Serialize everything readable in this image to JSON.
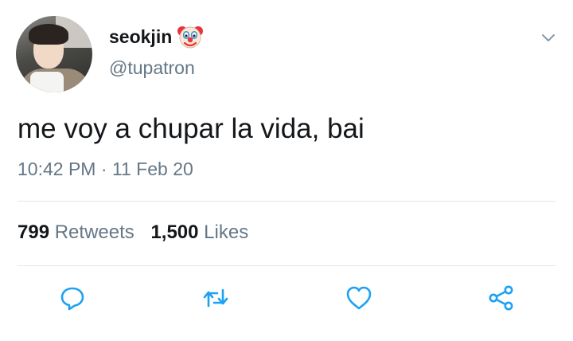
{
  "tweet": {
    "author": {
      "display_name": "seokjin",
      "handle": "@tupatron",
      "name_emoji": "clown-face-icon"
    },
    "text": "me voy a chupar la vida, bai",
    "time": "10:42 PM",
    "separator": "·",
    "date": "11 Feb 20",
    "stats": {
      "retweets_count": "799",
      "retweets_label": "Retweets",
      "likes_count": "1,500",
      "likes_label": "Likes"
    },
    "actions": [
      "reply-icon",
      "retweet-icon",
      "like-icon",
      "share-icon"
    ]
  },
  "colors": {
    "text_primary": "#14171a",
    "text_secondary": "#657786",
    "divider": "#e1e8ed",
    "icon": "#1da1f2"
  }
}
